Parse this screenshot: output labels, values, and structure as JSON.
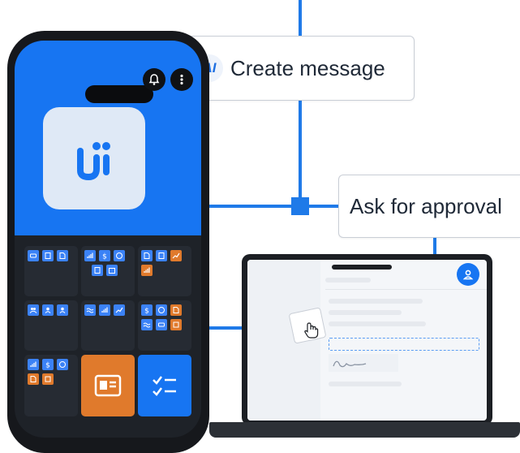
{
  "callouts": {
    "create_message": {
      "badge": "AI",
      "label": "Create message"
    },
    "ask_for_approval": {
      "label": "Ask for approval"
    }
  },
  "colors": {
    "accent_blue": "#1775f2",
    "connector": "#1f7ae8",
    "accent_orange": "#e07a2c",
    "phone_body": "#16181c",
    "tile_bg": "#262b33"
  },
  "phone": {
    "app_logo": "workflow-logo",
    "top_icons": [
      "bell-icon",
      "more-vertical-icon"
    ],
    "grid_cells": [
      {
        "icons": [
          "car-icon",
          "document-icon",
          "document-export-icon"
        ]
      },
      {
        "icons": [
          "bar-chart-icon",
          "dollar-icon",
          "clock-icon",
          "document-icon",
          "calendar-icon"
        ]
      },
      {
        "icons": [
          "document-export-icon",
          "document-icon",
          "trend-line-icon",
          "bar-chart-icon"
        ]
      },
      {
        "icons": [
          "group-icon",
          "user-icon",
          "user-icon"
        ]
      },
      {
        "icons": [
          "pulse-icon",
          "bar-chart-icon",
          "trend-line-icon"
        ]
      },
      {
        "icons": [
          "dollar-icon",
          "clock-icon",
          "document-export-icon",
          "pulse-icon",
          "car-icon",
          "scan-icon"
        ]
      },
      {
        "icons": [
          "bar-chart-icon",
          "dollar-icon",
          "clock-icon",
          "document-export-icon",
          "scan-icon"
        ]
      },
      {
        "icons": [
          "id-card-icon"
        ]
      },
      {
        "icons": [
          "checklist-icon"
        ]
      }
    ]
  },
  "laptop": {
    "avatar_icon": "user-icon",
    "drag_icon": "hand-cursor-icon",
    "signature": "signature"
  }
}
